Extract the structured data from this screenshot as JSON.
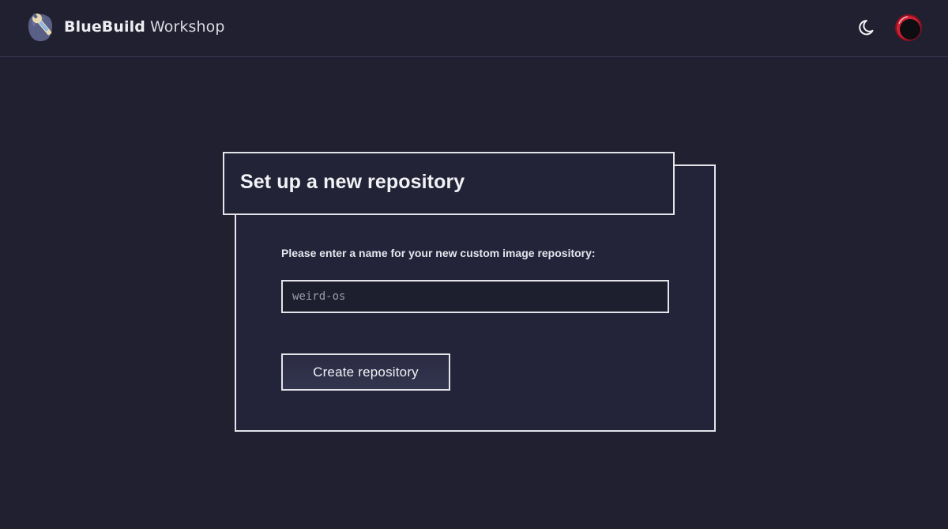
{
  "header": {
    "brand_name": "BlueBuild",
    "brand_suffix": "Workshop",
    "logo_icon": "bluebuild-logo",
    "theme_toggle_icon": "moon-icon",
    "avatar_icon": "avatar"
  },
  "card": {
    "title": "Set up a new repository",
    "field_label": "Please enter a name for your new custom image repository:",
    "input_value": "",
    "input_placeholder": "weird-os",
    "submit_label": "Create repository"
  },
  "colors": {
    "background": "#202030",
    "card_background": "#232439",
    "border": "#e4e4ea",
    "text": "#e8e8ee"
  }
}
